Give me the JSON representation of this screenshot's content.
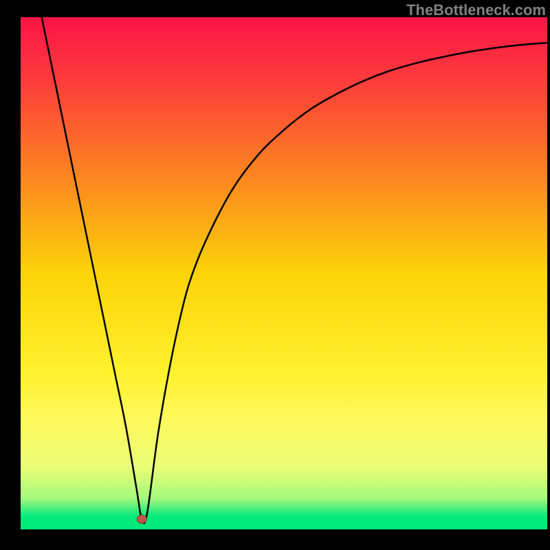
{
  "watermark": "TheBottleneck.com",
  "chart_data": {
    "type": "line",
    "title": "",
    "xlabel": "",
    "ylabel": "",
    "xlim": [
      0,
      100
    ],
    "ylim": [
      0,
      100
    ],
    "x": [
      4,
      6,
      8,
      10,
      12,
      14,
      16,
      18,
      20,
      22,
      23,
      24,
      26,
      28,
      30,
      32,
      35,
      40,
      45,
      50,
      55,
      60,
      65,
      70,
      75,
      80,
      85,
      90,
      95,
      100
    ],
    "values": [
      100,
      90,
      80,
      70,
      60,
      50,
      40,
      30,
      20,
      8,
      2,
      3,
      18,
      30,
      40,
      48,
      56,
      66,
      73,
      78,
      82,
      85,
      87.5,
      89.5,
      91,
      92.2,
      93.2,
      94,
      94.6,
      95
    ],
    "marker": {
      "x": 23,
      "y": 2
    },
    "background": {
      "type": "gradient",
      "stops": [
        {
          "pos": 0,
          "color": "#fc1447"
        },
        {
          "pos": 0.5,
          "color": "#fbd308"
        },
        {
          "pos": 0.78,
          "color": "#fff95a"
        },
        {
          "pos": 0.97,
          "color": "#00e97b"
        }
      ]
    }
  }
}
